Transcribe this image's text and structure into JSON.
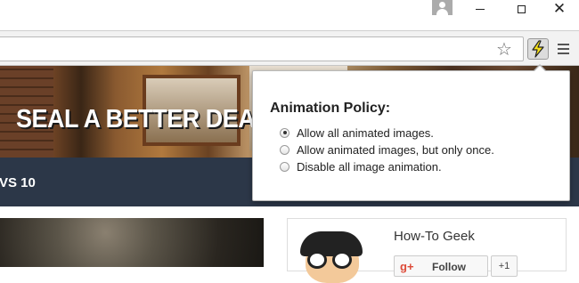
{
  "browser": {
    "star_glyph": "☆",
    "close_glyph": "✕"
  },
  "banner": {
    "headline": "SEAL A BETTER DEAL."
  },
  "navbar": {
    "partial_text": "VS 10"
  },
  "sidebar_card": {
    "site_name": "How-To Geek",
    "follow_label": "Follow",
    "google_glyph": "g+",
    "plus_one": "+1"
  },
  "popup": {
    "title": "Animation Policy:",
    "options": [
      {
        "label": "Allow all animated images.",
        "checked": true
      },
      {
        "label": "Allow animated images, but only once.",
        "checked": false
      },
      {
        "label": "Disable all image animation.",
        "checked": false
      }
    ]
  },
  "colors": {
    "navbar_bg": "#2c3748",
    "toolbar_bg": "#f2f2f2",
    "accent_orange": "#e9782a",
    "extension_bolt_yellow": "#f7e11a"
  }
}
